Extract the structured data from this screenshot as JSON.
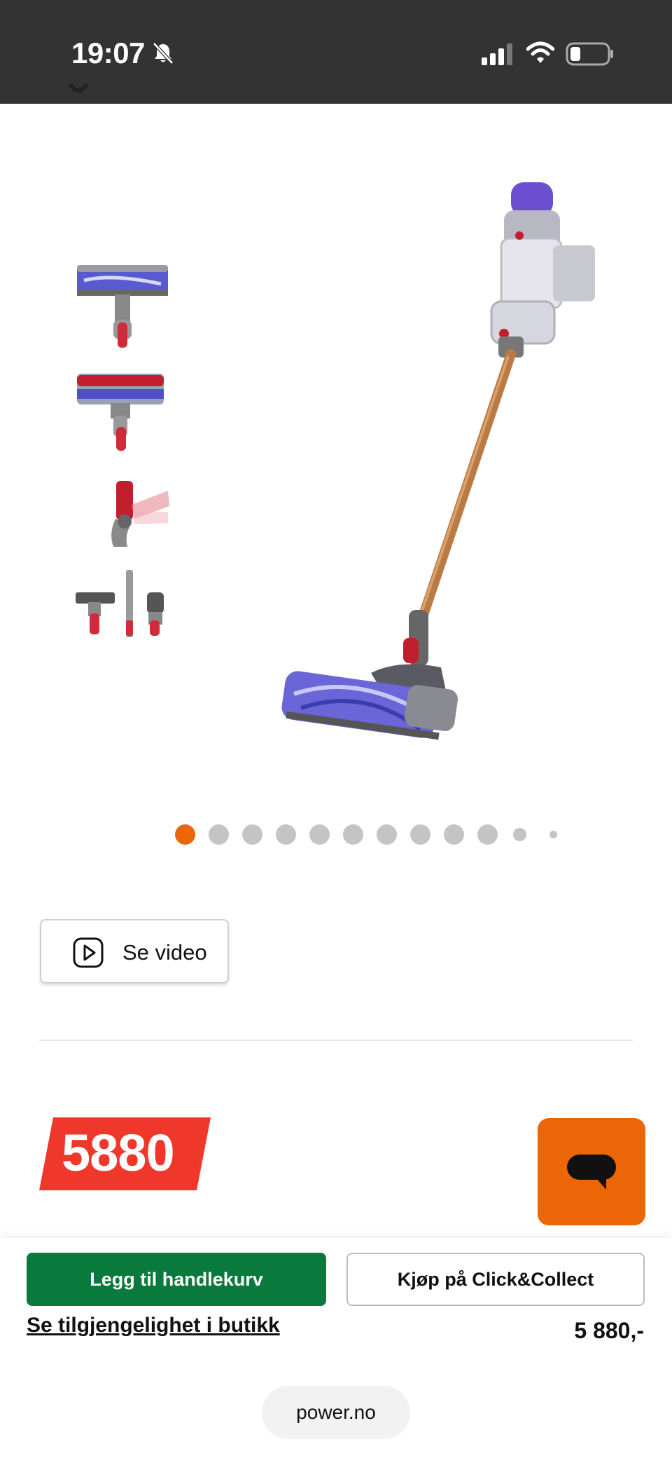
{
  "status_bar": {
    "time": "19:07",
    "icons": [
      "bell-slash-icon",
      "cellular-signal-icon",
      "wifi-icon",
      "battery-low-icon"
    ]
  },
  "gallery": {
    "thumbnails": [
      {
        "name": "motorbar-head-thumbnail"
      },
      {
        "name": "fluffy-head-thumbnail"
      },
      {
        "name": "angled-adapter-thumbnail"
      },
      {
        "name": "accessory-tools-thumbnail"
      }
    ],
    "main_image": "dyson-stick-vacuum-image",
    "dots_total": 12,
    "active_dot": 0
  },
  "video_button": {
    "label": "Se video",
    "icon": "play-icon"
  },
  "price": {
    "badge": "5880",
    "formatted": "5 880,-"
  },
  "actions": {
    "add_to_cart": "Legg til handlekurv",
    "click_collect": "Kjøp på Click&Collect",
    "availability_link": "Se tilgjengelighet i butikk"
  },
  "chat": {
    "icon": "chat-bubble-icon"
  },
  "browser": {
    "url": "power.no"
  },
  "colors": {
    "status_bar": "#333333",
    "accent_orange": "#ec6608",
    "price_red": "#f0372b",
    "cart_green": "#0a7a3c",
    "inactive_dot": "#c4c4c4"
  }
}
